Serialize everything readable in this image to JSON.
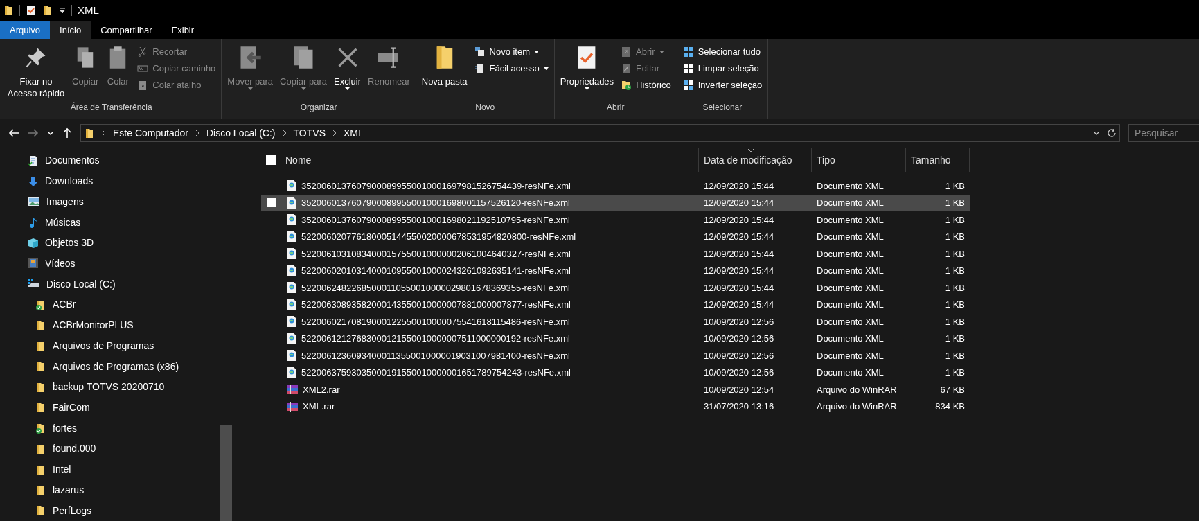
{
  "window": {
    "title": "XML"
  },
  "tabs": [
    {
      "label": "Arquivo",
      "kind": "file",
      "selected": false
    },
    {
      "label": "Início",
      "kind": "tab",
      "selected": true
    },
    {
      "label": "Compartilhar",
      "kind": "tab",
      "selected": false
    },
    {
      "label": "Exibir",
      "kind": "tab",
      "selected": false
    }
  ],
  "ribbon": {
    "groups": [
      {
        "label": "Área de Transferência",
        "items": [
          {
            "kind": "large",
            "label": "Fixar no Acesso rápido",
            "disabled": false,
            "dropdown": false
          },
          {
            "kind": "large",
            "label": "Copiar",
            "disabled": true,
            "dropdown": false
          },
          {
            "kind": "large",
            "label": "Colar",
            "disabled": true,
            "dropdown": false
          },
          {
            "kind": "stack",
            "items": [
              {
                "label": "Recortar",
                "disabled": true,
                "dropdown": false
              },
              {
                "label": "Copiar caminho",
                "disabled": true,
                "dropdown": false
              },
              {
                "label": "Colar atalho",
                "disabled": true,
                "dropdown": false
              }
            ]
          }
        ]
      },
      {
        "label": "Organizar",
        "items": [
          {
            "kind": "large",
            "label": "Mover para",
            "disabled": true,
            "dropdown": true
          },
          {
            "kind": "large",
            "label": "Copiar para",
            "disabled": true,
            "dropdown": true
          },
          {
            "kind": "large",
            "label": "Excluir",
            "disabled": false,
            "dropdown": true
          },
          {
            "kind": "large",
            "label": "Renomear",
            "disabled": true,
            "dropdown": false
          }
        ]
      },
      {
        "label": "Novo",
        "items": [
          {
            "kind": "large",
            "label": "Nova pasta",
            "disabled": false,
            "dropdown": false
          },
          {
            "kind": "stack",
            "items": [
              {
                "label": "Novo item",
                "disabled": false,
                "dropdown": true
              },
              {
                "label": "Fácil acesso",
                "disabled": false,
                "dropdown": true
              }
            ]
          }
        ]
      },
      {
        "label": "Abrir",
        "items": [
          {
            "kind": "large",
            "label": "Propriedades",
            "disabled": false,
            "dropdown": true
          },
          {
            "kind": "stack",
            "items": [
              {
                "label": "Abrir",
                "disabled": true,
                "dropdown": true
              },
              {
                "label": "Editar",
                "disabled": true,
                "dropdown": false
              },
              {
                "label": "Histórico",
                "disabled": false,
                "dropdown": false
              }
            ]
          }
        ]
      },
      {
        "label": "Selecionar",
        "items": [
          {
            "kind": "stack",
            "items": [
              {
                "label": "Selecionar tudo",
                "disabled": false,
                "dropdown": false
              },
              {
                "label": "Limpar seleção",
                "disabled": false,
                "dropdown": false
              },
              {
                "label": "Inverter seleção",
                "disabled": false,
                "dropdown": false
              }
            ]
          }
        ]
      }
    ]
  },
  "address_bar": {
    "path": [
      "Este Computador",
      "Disco Local (C:)",
      "TOTVS",
      "XML"
    ],
    "search_placeholder": "Pesquisar"
  },
  "sidebar": {
    "items": [
      {
        "label": "Documentos",
        "kind": "documents"
      },
      {
        "label": "Downloads",
        "kind": "downloads"
      },
      {
        "label": "Imagens",
        "kind": "images"
      },
      {
        "label": "Músicas",
        "kind": "music"
      },
      {
        "label": "Objetos 3D",
        "kind": "objects3d"
      },
      {
        "label": "Vídeos",
        "kind": "videos"
      },
      {
        "label": "Disco Local (C:)",
        "kind": "drive",
        "children": [
          {
            "label": "ACBr",
            "kind": "folder-synced"
          },
          {
            "label": "ACBrMonitorPLUS",
            "kind": "folder"
          },
          {
            "label": "Arquivos de Programas",
            "kind": "folder"
          },
          {
            "label": "Arquivos de Programas (x86)",
            "kind": "folder"
          },
          {
            "label": "backup TOTVS 20200710",
            "kind": "folder"
          },
          {
            "label": "FairCom",
            "kind": "folder"
          },
          {
            "label": "fortes",
            "kind": "folder-synced"
          },
          {
            "label": "found.000",
            "kind": "folder"
          },
          {
            "label": "Intel",
            "kind": "folder"
          },
          {
            "label": "lazarus",
            "kind": "folder"
          },
          {
            "label": "PerfLogs",
            "kind": "folder"
          }
        ]
      }
    ]
  },
  "file_list": {
    "select_all_checked": false,
    "columns": [
      "Nome",
      "Data de modificação",
      "Tipo",
      "Tamanho"
    ],
    "rows": [
      {
        "kind": "xml",
        "name": "35200601376079000899550010001697981526754439-resNFe.xml",
        "date": "12/09/2020 15:44",
        "type": "Documento XML",
        "size": "1 KB",
        "hovered": false
      },
      {
        "kind": "xml",
        "name": "35200601376079000899550010001698001157526120-resNFe.xml",
        "date": "12/09/2020 15:44",
        "type": "Documento XML",
        "size": "1 KB",
        "hovered": true
      },
      {
        "kind": "xml",
        "name": "35200601376079000899550010001698021192510795-resNFe.xml",
        "date": "12/09/2020 15:44",
        "type": "Documento XML",
        "size": "1 KB",
        "hovered": false
      },
      {
        "kind": "xml",
        "name": "522006020776180005144550020000678531954820800-resNFe.xml",
        "date": "12/09/2020 15:44",
        "type": "Documento XML",
        "size": "1 KB",
        "hovered": false
      },
      {
        "kind": "xml",
        "name": "52200610310834000157550010000002061004640327-resNFe.xml",
        "date": "12/09/2020 15:44",
        "type": "Documento XML",
        "size": "1 KB",
        "hovered": false
      },
      {
        "kind": "xml",
        "name": "52200602010314000109550010000243261092635141-resNFe.xml",
        "date": "12/09/2020 15:44",
        "type": "Documento XML",
        "size": "1 KB",
        "hovered": false
      },
      {
        "kind": "xml",
        "name": "52200624822685000110550010000029801678369355-resNFe.xml",
        "date": "12/09/2020 15:44",
        "type": "Documento XML",
        "size": "1 KB",
        "hovered": false
      },
      {
        "kind": "xml",
        "name": "52200630893582000143550010000007881000007877-resNFe.xml",
        "date": "12/09/2020 15:44",
        "type": "Documento XML",
        "size": "1 KB",
        "hovered": false
      },
      {
        "kind": "xml",
        "name": "52200602170819000122550010000075541618115486-resNFe.xml",
        "date": "10/09/2020 12:56",
        "type": "Documento XML",
        "size": "1 KB",
        "hovered": false
      },
      {
        "kind": "xml",
        "name": "52200612127683000121550010000007511000000192-resNFe.xml",
        "date": "10/09/2020 12:56",
        "type": "Documento XML",
        "size": "1 KB",
        "hovered": false
      },
      {
        "kind": "xml",
        "name": "52200612360934000113550010000019031007981400-resNFe.xml",
        "date": "10/09/2020 12:56",
        "type": "Documento XML",
        "size": "1 KB",
        "hovered": false
      },
      {
        "kind": "xml",
        "name": "52200637593035000191550010000001651789754243-resNFe.xml",
        "date": "10/09/2020 12:56",
        "type": "Documento XML",
        "size": "1 KB",
        "hovered": false
      },
      {
        "kind": "rar",
        "name": "XML2.rar",
        "date": "10/09/2020 12:54",
        "type": "Arquivo do WinRAR",
        "size": "67 KB",
        "hovered": false
      },
      {
        "kind": "rar",
        "name": "XML.rar",
        "date": "31/07/2020 13:16",
        "type": "Arquivo do WinRAR",
        "size": "834 KB",
        "hovered": false
      }
    ]
  }
}
